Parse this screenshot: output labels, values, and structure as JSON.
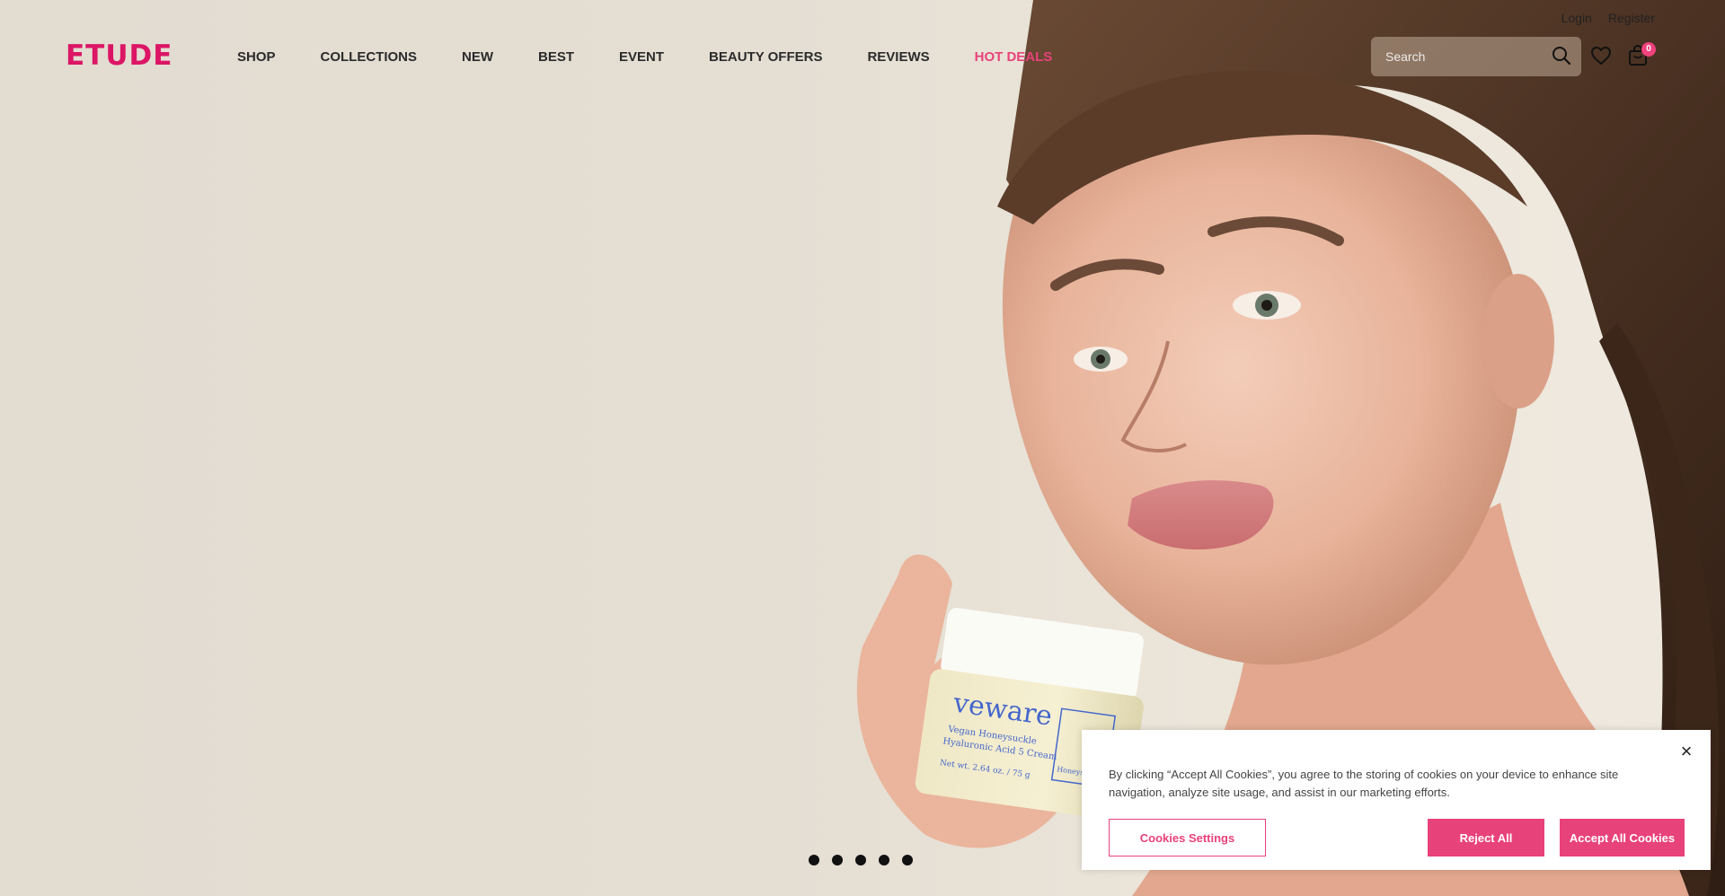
{
  "brand": {
    "logo": "ETUDE",
    "accent": "#dc1565",
    "hot_color": "#e8427a"
  },
  "utility": {
    "login": "Login",
    "register": "Register"
  },
  "nav": {
    "items": [
      "SHOP",
      "COLLECTIONS",
      "NEW",
      "BEST",
      "EVENT",
      "BEAUTY OFFERS",
      "REVIEWS",
      "HOT DEALS"
    ]
  },
  "search": {
    "placeholder": "Search"
  },
  "cart": {
    "count": "0"
  },
  "product": {
    "brand": "veware",
    "line1": "Vegan Honeysuckle",
    "line2": "Hyaluronic Acid 5 Cream",
    "net": "Net wt. 2.64 oz. / 75 g",
    "box": "Honeysuckle complex"
  },
  "cookies": {
    "text": "By clicking “Accept All Cookies”, you agree to the storing of cookies on your device to enhance site navigation, analyze site usage, and assist in our marketing efforts.",
    "settings": "Cookies Settings",
    "reject": "Reject All",
    "accept": "Accept All Cookies",
    "close": "×"
  },
  "carousel": {
    "slides": 5
  }
}
